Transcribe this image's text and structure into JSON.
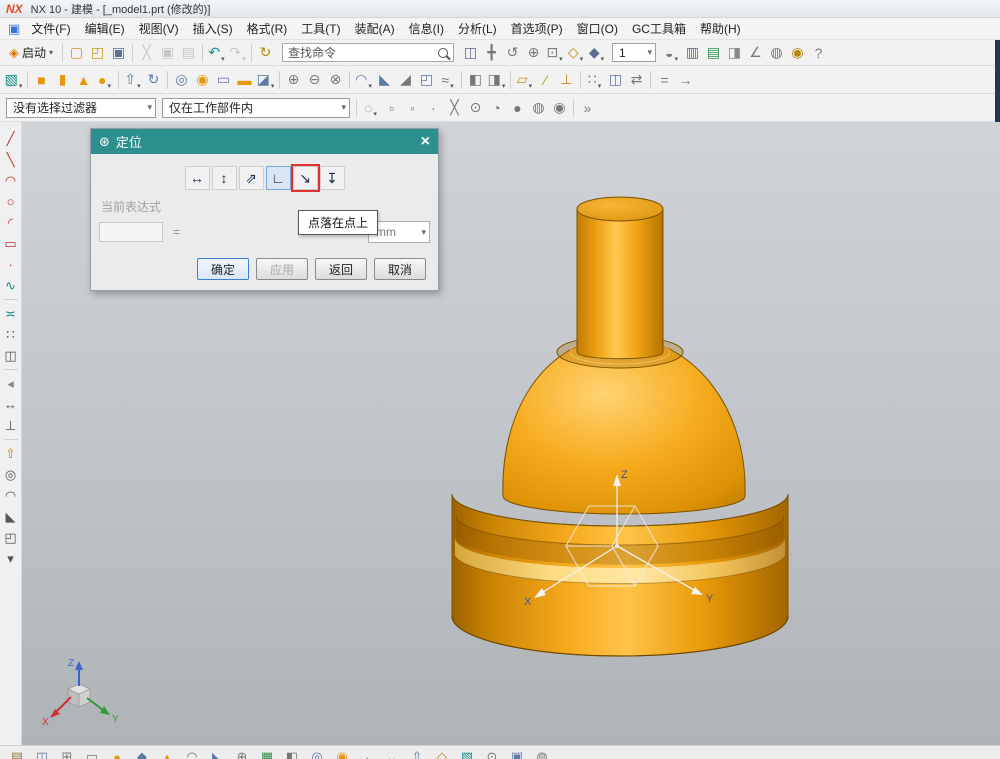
{
  "window": {
    "logo": "NX",
    "title": "NX 10 - 建模 - [_model1.prt (修改的)]"
  },
  "glyphs": {
    "chevron_down": "▾",
    "close": "×",
    "gear": "⊛",
    "window_icon": "▣"
  },
  "menu": {
    "items": [
      {
        "name": "menu-file",
        "label": "文件(F)"
      },
      {
        "name": "menu-edit",
        "label": "编辑(E)"
      },
      {
        "name": "menu-view",
        "label": "视图(V)"
      },
      {
        "name": "menu-insert",
        "label": "插入(S)"
      },
      {
        "name": "menu-format",
        "label": "格式(R)"
      },
      {
        "name": "menu-tools",
        "label": "工具(T)"
      },
      {
        "name": "menu-assemblies",
        "label": "装配(A)"
      },
      {
        "name": "menu-information",
        "label": "信息(I)"
      },
      {
        "name": "menu-analysis",
        "label": "分析(L)"
      },
      {
        "name": "menu-preferences",
        "label": "首选项(P)"
      },
      {
        "name": "menu-window",
        "label": "窗口(O)"
      },
      {
        "name": "menu-gc-toolbox",
        "label": "GC工具箱"
      },
      {
        "name": "menu-help",
        "label": "帮助(H)"
      }
    ]
  },
  "toolbar1": {
    "start_label": "启动",
    "start_icon_glyph": "◈",
    "search_value": "查找命令",
    "combo_value": "1",
    "left_icons": [
      {
        "name": "new-file-icon",
        "glyph": "▢",
        "color": "#c79a1e"
      },
      {
        "name": "open-icon",
        "glyph": "◰",
        "color": "#c79a1e"
      },
      {
        "name": "save-icon",
        "glyph": "▣",
        "color": "#5b6e8f"
      },
      {
        "sep": true
      },
      {
        "name": "cut-icon",
        "glyph": "╳",
        "color": "#777",
        "grayed": true
      },
      {
        "name": "copy-icon",
        "glyph": "▣",
        "color": "#777",
        "grayed": true
      },
      {
        "name": "paste-icon",
        "glyph": "▤",
        "color": "#777",
        "grayed": true
      },
      {
        "sep": true
      },
      {
        "name": "undo-icon",
        "glyph": "↶",
        "color": "#0b8f8f",
        "dd": true
      },
      {
        "name": "redo-icon",
        "glyph": "↷",
        "color": "#777",
        "grayed": true,
        "dd": true
      },
      {
        "sep": true
      },
      {
        "name": "refresh-icon",
        "glyph": "↻",
        "color": "#b8860b"
      }
    ],
    "right_icons_a": [
      {
        "name": "touch-mode-icon",
        "glyph": "◫",
        "color": "#5b6e8f"
      },
      {
        "name": "pan-icon",
        "glyph": "╋",
        "color": "#777"
      },
      {
        "name": "rotate-view-icon",
        "glyph": "↺",
        "color": "#777"
      },
      {
        "name": "zoom-icon",
        "glyph": "⊕",
        "color": "#777"
      },
      {
        "name": "fit-view-icon",
        "glyph": "⊡",
        "color": "#777",
        "dd": true
      },
      {
        "name": "orient-view-icon",
        "glyph": "◇",
        "color": "#b8860b",
        "dd": true
      },
      {
        "name": "rendering-style-icon",
        "glyph": "◆",
        "color": "#5b6e8f",
        "dd": true
      }
    ],
    "right_icons_b": [
      {
        "name": "show-hide-icon",
        "glyph": "◒",
        "color": "#777",
        "dd": true
      },
      {
        "name": "window-icon",
        "glyph": "▥",
        "color": "#5b6e8f"
      },
      {
        "name": "layer-settings-icon",
        "glyph": "▤",
        "color": "#2e8f4e"
      },
      {
        "name": "view-section-icon",
        "glyph": "◨",
        "color": "#888"
      },
      {
        "name": "measure-icon",
        "glyph": "∠",
        "color": "#777"
      },
      {
        "name": "object-display-icon",
        "glyph": "◍",
        "color": "#777"
      },
      {
        "name": "selection-icon",
        "glyph": "◉",
        "color": "#b8860b"
      },
      {
        "name": "help-icon",
        "glyph": "?",
        "color": "#777"
      }
    ]
  },
  "toolbar2": {
    "icons": [
      {
        "name": "sketch-icon",
        "glyph": "▧",
        "color": "#0e8f85",
        "dd": true
      },
      {
        "sep": true
      },
      {
        "name": "block-icon",
        "glyph": "■",
        "color": "#e8960a"
      },
      {
        "name": "cylinder-icon",
        "glyph": "▮",
        "color": "#e8960a"
      },
      {
        "name": "cone-icon",
        "glyph": "▲",
        "color": "#e8960a"
      },
      {
        "name": "sphere-icon",
        "glyph": "●",
        "color": "#e8960a",
        "dd": true
      },
      {
        "sep": true
      },
      {
        "name": "extrude-icon",
        "glyph": "⇧",
        "color": "#5b7aa6",
        "dd": true
      },
      {
        "name": "revolve-icon",
        "glyph": "↻",
        "color": "#5b7aa6"
      },
      {
        "sep": true
      },
      {
        "name": "hole-icon",
        "glyph": "◎",
        "color": "#5b7aa6"
      },
      {
        "name": "boss-icon",
        "glyph": "◉",
        "color": "#e8960a"
      },
      {
        "name": "pocket-icon",
        "glyph": "▭",
        "color": "#5b7aa6"
      },
      {
        "name": "pad-icon",
        "glyph": "▬",
        "color": "#e8960a"
      },
      {
        "name": "emboss-icon",
        "glyph": "◪",
        "color": "#5b7aa6",
        "dd": true
      },
      {
        "sep": true
      },
      {
        "name": "unite-icon",
        "glyph": "⊕",
        "color": "#777"
      },
      {
        "name": "subtract-icon",
        "glyph": "⊖",
        "color": "#777"
      },
      {
        "name": "intersect-icon",
        "glyph": "⊗",
        "color": "#777"
      },
      {
        "sep": true
      },
      {
        "name": "edge-blend-icon",
        "glyph": "◠",
        "color": "#5b7aa6",
        "dd": true
      },
      {
        "name": "chamfer-icon",
        "glyph": "◣",
        "color": "#5b7aa6"
      },
      {
        "name": "draft-icon",
        "glyph": "◢",
        "color": "#777"
      },
      {
        "name": "shell-icon",
        "glyph": "◰",
        "color": "#5b7aa6"
      },
      {
        "name": "thread-icon",
        "glyph": "≈",
        "color": "#777",
        "dd": true
      },
      {
        "sep": true
      },
      {
        "name": "trim-body-icon",
        "glyph": "◧",
        "color": "#777"
      },
      {
        "name": "split-body-icon",
        "glyph": "◨",
        "color": "#777",
        "dd": true
      },
      {
        "sep": true
      },
      {
        "name": "datum-plane-icon",
        "glyph": "▱",
        "color": "#c08a2a",
        "dd": true
      },
      {
        "name": "datum-axis-icon",
        "glyph": "∕",
        "color": "#c08a2a"
      },
      {
        "name": "datum-csys-icon",
        "glyph": "⊥",
        "color": "#c08a2a"
      },
      {
        "sep": true
      },
      {
        "name": "pattern-feature-icon",
        "glyph": "∷",
        "color": "#5b7aa6",
        "dd": true
      },
      {
        "name": "mirror-feature-icon",
        "glyph": "◫",
        "color": "#5b7aa6"
      },
      {
        "name": "move-object-icon",
        "glyph": "⇄",
        "color": "#777"
      },
      {
        "sep": true
      },
      {
        "name": "expression-icon",
        "glyph": "=",
        "color": "#777"
      },
      {
        "name": "edit-feature-icon",
        "glyph": "→",
        "color": "#777"
      }
    ]
  },
  "toolbar3": {
    "filter_value": "没有选择过滤器",
    "scope_value": "仅在工作部件内",
    "icons": [
      {
        "name": "snap-point-icon",
        "glyph": "◌",
        "color": "#777",
        "dd": true
      },
      {
        "name": "end-point-icon",
        "glyph": "▫",
        "color": "#777"
      },
      {
        "name": "mid-point-icon",
        "glyph": "◦",
        "color": "#777"
      },
      {
        "name": "control-point-icon",
        "glyph": "∙",
        "color": "#777"
      },
      {
        "name": "intersection-point-icon",
        "glyph": "╳",
        "color": "#777"
      },
      {
        "name": "arc-center-icon",
        "glyph": "⊙",
        "color": "#777"
      },
      {
        "name": "quadrant-point-icon",
        "glyph": "◔",
        "color": "#777"
      },
      {
        "name": "existing-point-icon",
        "glyph": "●",
        "color": "#777"
      },
      {
        "name": "point-on-curve-icon",
        "glyph": "◍",
        "color": "#777"
      },
      {
        "name": "point-on-face-icon",
        "glyph": "◉",
        "color": "#777"
      },
      {
        "sep": true
      },
      {
        "name": "more-options-icon",
        "glyph": "»",
        "color": "#777"
      }
    ]
  },
  "sidebar": {
    "icons": [
      {
        "name": "profile-icon",
        "glyph": "╱",
        "color": "#c03030"
      },
      {
        "name": "line-icon",
        "glyph": "╲",
        "color": "#c03030"
      },
      {
        "name": "arc-icon",
        "glyph": "◠",
        "color": "#c03030"
      },
      {
        "name": "circle-icon",
        "glyph": "○",
        "color": "#c03030"
      },
      {
        "name": "fillet-icon",
        "glyph": "◜",
        "color": "#c03030"
      },
      {
        "name": "rectangle-icon",
        "glyph": "▭",
        "color": "#c03030"
      },
      {
        "name": "point-icon",
        "glyph": "∙",
        "color": "#c03030"
      },
      {
        "name": "spline-icon",
        "glyph": "∿",
        "color": "#0e8f85"
      },
      {
        "sep": true
      },
      {
        "name": "offset-curve-icon",
        "glyph": "≍",
        "color": "#0e8f85"
      },
      {
        "name": "pattern-curve-icon",
        "glyph": "∷",
        "color": "#555"
      },
      {
        "name": "mirror-curve-icon",
        "glyph": "◫",
        "color": "#555"
      },
      {
        "sep": true
      },
      {
        "name": "collapse-icon",
        "glyph": "◂",
        "color": "#888"
      },
      {
        "name": "dimension-icon",
        "glyph": "↔",
        "color": "#555"
      },
      {
        "name": "constraint-icon",
        "glyph": "⊥",
        "color": "#555"
      },
      {
        "sep": true
      },
      {
        "name": "extrude-shortcut-icon",
        "glyph": "⇧",
        "color": "#b8860b"
      },
      {
        "name": "hole-shortcut-icon",
        "glyph": "◎",
        "color": "#555"
      },
      {
        "name": "blend-shortcut-icon",
        "glyph": "◠",
        "color": "#555"
      },
      {
        "name": "chamfer-shortcut-icon",
        "glyph": "◣",
        "color": "#555"
      },
      {
        "name": "shell-shortcut-icon",
        "glyph": "◰",
        "color": "#555"
      },
      {
        "name": "more-icon",
        "glyph": "▾",
        "color": "#555"
      }
    ]
  },
  "dialog": {
    "title": "定位",
    "position_buttons": [
      {
        "name": "horizontal-button",
        "glyph": "↔"
      },
      {
        "name": "vertical-button",
        "glyph": "↕"
      },
      {
        "name": "parallel-button",
        "glyph": "⇗"
      },
      {
        "name": "perpendicular-button",
        "glyph": "∟",
        "selected": true
      },
      {
        "name": "point-on-point-button",
        "glyph": "↘",
        "highlighted": true
      },
      {
        "name": "point-on-line-button",
        "glyph": "↧"
      }
    ],
    "expression_label": "当前表达式",
    "expression_value": "",
    "equals": "=",
    "unit_value": "mm",
    "tooltip": "点落在点上",
    "buttons": {
      "ok": "确定",
      "apply": "应用",
      "back": "返回",
      "cancel": "取消"
    }
  },
  "viewport": {
    "wcs": {
      "x": "X",
      "y": "Y",
      "z": "Z"
    },
    "triad": {
      "x": "X",
      "y": "Y",
      "z": "Z"
    }
  },
  "bottombar": {
    "icons": [
      {
        "name": "dock-icon",
        "glyph": "▤",
        "color": "#8a7a4a"
      },
      {
        "name": "dock-icon",
        "glyph": "◫",
        "color": "#5b7aa6"
      },
      {
        "name": "dock-icon",
        "glyph": "⊞",
        "color": "#777"
      },
      {
        "name": "dock-icon",
        "glyph": "▭",
        "color": "#777"
      },
      {
        "name": "dock-icon",
        "glyph": "●",
        "color": "#e8960a"
      },
      {
        "name": "dock-icon",
        "glyph": "◆",
        "color": "#5b7aa6"
      },
      {
        "name": "dock-icon",
        "glyph": "▲",
        "color": "#e8960a"
      },
      {
        "name": "dock-icon",
        "glyph": "◠",
        "color": "#777"
      },
      {
        "name": "dock-icon",
        "glyph": "◣",
        "color": "#5b7aa6"
      },
      {
        "name": "dock-icon",
        "glyph": "⊕",
        "color": "#777"
      },
      {
        "name": "dock-icon",
        "glyph": "▦",
        "color": "#2e8f4e"
      },
      {
        "name": "dock-icon",
        "glyph": "◧",
        "color": "#777"
      },
      {
        "name": "dock-icon",
        "glyph": "◎",
        "color": "#5b7aa6"
      },
      {
        "name": "dock-icon",
        "glyph": "◉",
        "color": "#e8960a"
      },
      {
        "name": "dock-icon",
        "glyph": "∙",
        "color": "#777"
      },
      {
        "name": "dock-icon",
        "glyph": "↔",
        "color": "#777"
      },
      {
        "name": "dock-icon",
        "glyph": "⇧",
        "color": "#5b7aa6"
      },
      {
        "name": "dock-icon",
        "glyph": "◇",
        "color": "#b8860b"
      },
      {
        "name": "dock-icon",
        "glyph": "▧",
        "color": "#0e8f85"
      },
      {
        "name": "dock-icon",
        "glyph": "⊙",
        "color": "#777"
      },
      {
        "name": "dock-icon",
        "glyph": "▣",
        "color": "#5b7aa6"
      },
      {
        "name": "dock-icon",
        "glyph": "◍",
        "color": "#777"
      }
    ]
  },
  "colors": {
    "dialog_header_teal": "#2e8f8f",
    "highlight_red": "#e03030",
    "model_orange": "#f2a30b",
    "model_orange_light": "#ffcf5e",
    "model_orange_dark": "#a86c00",
    "viewport_gray_top": "#d0d4d7",
    "viewport_gray_bottom": "#aeb3b7"
  }
}
